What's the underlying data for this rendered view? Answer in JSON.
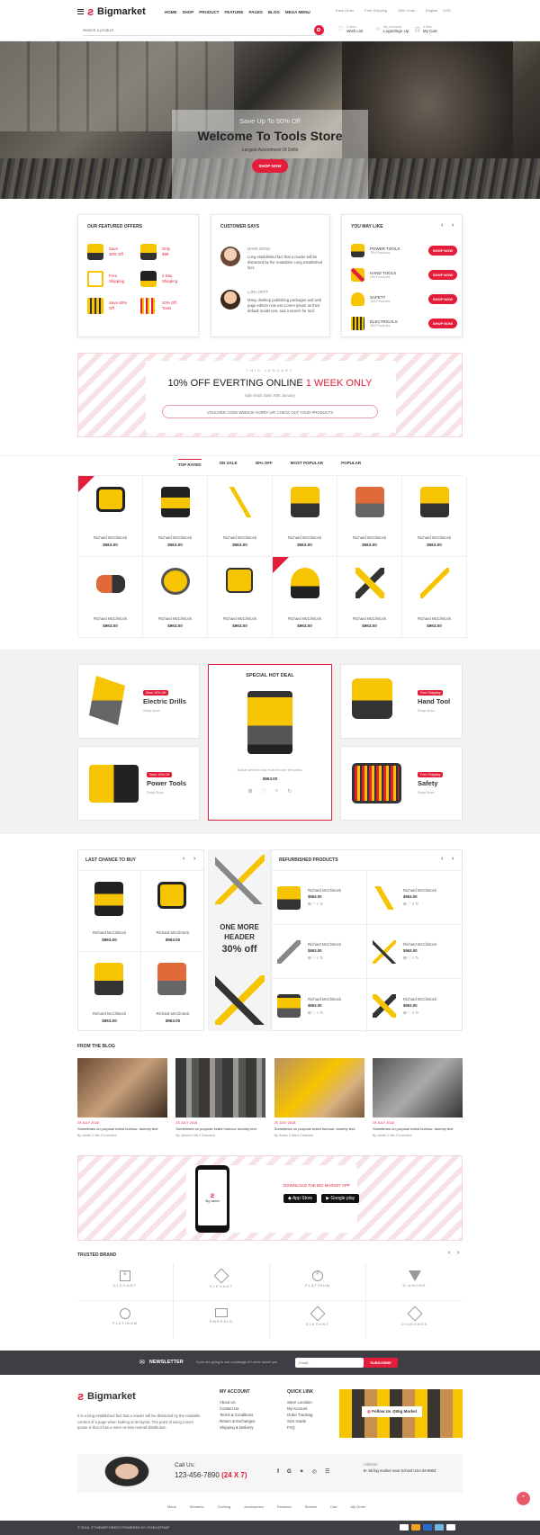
{
  "header": {
    "logo": "Bigmarket",
    "nav": [
      "HOME",
      "SHOP",
      "PRODUCT",
      "FEATURE",
      "PAGES",
      "BLOG",
      "MEGA MENU"
    ],
    "top_links": [
      "Track Order",
      "Free Shipping",
      "Offer Zone"
    ],
    "language": "English",
    "currency": "USD",
    "search_placeholder": "Search a product",
    "wishlist_count": "0 Item",
    "wishlist_label": "Wish List",
    "account_title": "My Account",
    "account_label": "Login/Sign Up",
    "cart_count": "0 Item",
    "cart_label": "My Cart"
  },
  "hero": {
    "pretitle": "Save Up To 50% Off",
    "title": "Welcome To Tools Store",
    "subtitle": "Largest Assortment Of Drills",
    "button": "SHOP NOW"
  },
  "featured": {
    "title": "OUR FEATURED OFFERS",
    "items": [
      {
        "l1": "Save",
        "l2": "30% Off"
      },
      {
        "l1": "Only",
        "l2": "$99"
      },
      {
        "l1": "Free",
        "l2": "Shipping"
      },
      {
        "l1": "2 Day",
        "l2": "Shipping"
      },
      {
        "l1": "Save 60%",
        "l2": "Off"
      },
      {
        "l1": "20% Off",
        "l2": "Tools"
      }
    ]
  },
  "testimonials": {
    "title": "CUSTOMER SAYS",
    "items": [
      {
        "name": "MARK BOND",
        "text": "Long established fact that a reader will be distracted by the readables Long established fact."
      },
      {
        "name": "LARA OFFT",
        "text": "Many desktop publishing packages and web page editors now use Lorem Ipsum as their default model text, and a search for lord."
      }
    ]
  },
  "you_may_like": {
    "title": "YOU MAY LIKE",
    "items": [
      {
        "name": "POWER TOOLS",
        "count": "765 Products",
        "button": "SHOP NOW"
      },
      {
        "name": "HAND TOOLS",
        "count": "265 Products",
        "button": "SHOP NOW"
      },
      {
        "name": "SAFETY",
        "count": "165 Products",
        "button": "SHOP NOW"
      },
      {
        "name": "ELECTRICALS",
        "count": "365 Products",
        "button": "SHOP NOW"
      }
    ]
  },
  "promo": {
    "label": "THIS JANUARY",
    "headline": "10% OFF EVERTING ONLINE",
    "highlight": "1 WEEK ONLY",
    "sub": "Sale Ends Date 20th January",
    "voucher": "VOUCHER CODE WEEK20 HURRY UP! CHECK OUT YOUR PRODUCTS"
  },
  "product_tabs": [
    "TOP RATED",
    "ON SALE",
    "30% OFF",
    "MOST POPULAR",
    "POPULAR"
  ],
  "products": [
    {
      "name": "Richard McClintock",
      "price": "$963.00",
      "badge": "Sale"
    },
    {
      "name": "Richard McClintock",
      "price": "$963.00",
      "badge": ""
    },
    {
      "name": "Richard McClintock",
      "price": "$963.00",
      "badge": ""
    },
    {
      "name": "Richard McClintock",
      "price": "$963.00",
      "badge": ""
    },
    {
      "name": "Richard McClintock",
      "price": "$963.00",
      "badge": ""
    },
    {
      "name": "Richard McClintock",
      "price": "$963.00",
      "badge": ""
    },
    {
      "name": "Richard McClintock",
      "price": "$963.00",
      "badge": ""
    },
    {
      "name": "Richard McClintock",
      "price": "$963.00",
      "badge": ""
    },
    {
      "name": "Richard McClintock",
      "price": "$963.00",
      "badge": ""
    },
    {
      "name": "Richard McClintock",
      "price": "$963.00",
      "badge": "Sale"
    },
    {
      "name": "Richard McClintock",
      "price": "$963.00",
      "badge": ""
    },
    {
      "name": "Richard McClintock",
      "price": "$963.00",
      "badge": ""
    }
  ],
  "category_banners": [
    {
      "tag": "Save 10% Off",
      "title": "Electric Drills",
      "link": "Shop Now"
    },
    {
      "tag": "Free Shipping",
      "title": "Hand Tool",
      "link": "Shop Now"
    },
    {
      "tag": "Save 10% Off",
      "title": "Power Tools",
      "link": "Shop Now"
    },
    {
      "tag": "Free Shipping",
      "title": "Safety",
      "link": "Shop Now"
    }
  ],
  "hot_deal": {
    "title": "SPECIAL HOT DEAL",
    "desc": "Actual services has evolved over the years.",
    "price": "$963.00"
  },
  "last_chance": {
    "title": "LAST CHANCE TO BUY",
    "items": [
      {
        "name": "Richard McClintock",
        "price": "$963.00"
      },
      {
        "name": "Richard McClintock",
        "price": "$963.00"
      },
      {
        "name": "Richard McClintock",
        "price": "$963.00"
      },
      {
        "name": "Richard McClintock",
        "price": "$963.00"
      }
    ]
  },
  "middle_banner": {
    "l1": "ONE MORE",
    "l2": "HEADER",
    "l3": "30% off"
  },
  "refurbished": {
    "title": "REFURBISHED PRODUCTS",
    "items": [
      {
        "name": "Richard McClintock",
        "price": "$963.00"
      },
      {
        "name": "Richard McClintock",
        "price": "$963.00"
      },
      {
        "name": "Richard McClintock",
        "price": "$963.00"
      },
      {
        "name": "Richard McClintock",
        "price": "$963.00"
      },
      {
        "name": "Richard McClintock",
        "price": "$963.00"
      },
      {
        "name": "Richard McClintock",
        "price": "$963.00"
      }
    ]
  },
  "blog": {
    "title": "FROM THE BLOG",
    "posts": [
      {
        "date": "25 JULY 2018",
        "text": "Sometimes on purpose ected humour. dummy text.",
        "meta": "By: Admin  0 Hits  0 Comment"
      },
      {
        "date": "25 JULY 2018",
        "text": "Sometimes on purpose ected humour. dummy text.",
        "meta": "By: Admin  0 Hits  0 Comment"
      },
      {
        "date": "25 JULY 2018",
        "text": "Sometimes on purpose ected humour. dummy text.",
        "meta": "By: Admin  0 Hits  0 Comment"
      },
      {
        "date": "25 JULY 2018",
        "text": "Sometimes on purpose ected humour. dummy text.",
        "meta": "By: Admin  0 Hits  0 Comment"
      }
    ]
  },
  "app": {
    "title": "DOWNLOAD THE BIG MARKET APP",
    "appstore": "App Store",
    "googleplay": "Google play",
    "phone_logo": "Big market"
  },
  "brands": {
    "title": "TRUSTED BRAND",
    "items": [
      "ELEGANT",
      "ELEGANT",
      "PLATINUM",
      "DIAMOND",
      "PLATINUM",
      "EMERALD",
      "ELEGANT",
      "DIAMONDS"
    ]
  },
  "newsletter": {
    "title": "NEWSLETTER",
    "text": "If you are going to use a passage of Lorem ipsum you",
    "placeholder": "Email...",
    "button": "SUBSCRIBE"
  },
  "footer": {
    "about": "It is a long established fact that a reader will be distracted by the readable content of a page when looking at its layout. The point of using Lorem Ipsum is that it has a more-or-less normal distribution",
    "account_title": "MY ACCOUNT",
    "account_links": [
      "About Us",
      "Contact Us",
      "Terms & Conditions",
      "Return & Exchanges",
      "Shipping & Delivery"
    ],
    "quick_title": "QUICK LINK",
    "quick_links": [
      "Store Location",
      "My Account",
      "Order Tracking",
      "Size Guide",
      "FAQ"
    ],
    "follow": "Follow Us @Big Market",
    "call_label": "Call Us:",
    "phone": "123-456-7890",
    "hours": "(24 X 7)",
    "address_label": "Address",
    "address": "B- 56 big market near School USA 63-8904",
    "bottom_links": [
      "Mens",
      "Womens",
      "Clothing",
      "Accessories",
      "Featured",
      "Service",
      "Cart",
      "My Order"
    ],
    "copyright": "© 2018, ©THEMEFOREST POWERED BY PIXELSTRAP"
  },
  "colors": {
    "accent": "#e41e3a",
    "dark": "#3d3f45"
  }
}
